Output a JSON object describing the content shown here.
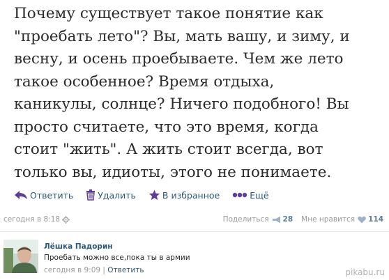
{
  "post": {
    "text": "Почему существует такое понятие как\n\"проебать лето\"? Вы, мать вашу, и зиму, и\nвесну, и осень проебываете. Чем же лето\nтакое особенное? Время отдыха,\nканикулы, солнце? Ничего подобного! Вы\nпросто считаете, что это время, когда\nстоит \"жить\". А жить стоит всегда, вот\nтолько вы, идиоты, этого не понимаете."
  },
  "actions": {
    "reply": "Ответить",
    "delete": "Удалить",
    "favorite": "В избранное",
    "more": "Ещё"
  },
  "meta": {
    "time": "сегодня в 8:18",
    "share_label": "Поделиться",
    "share_count": "28",
    "like_label": "Мне нравится",
    "like_count": "114"
  },
  "comment": {
    "author": "Лёшка Падорин",
    "text": "Проебать можно все,пока ты в армии",
    "time": "сегодня в 9:09",
    "separator": " | ",
    "reply": "Ответить"
  },
  "watermark": "pikabu.ru",
  "colors": {
    "link": "#2b587a",
    "accent_purple": "#5b3d9a",
    "meta_gray": "#999999"
  }
}
